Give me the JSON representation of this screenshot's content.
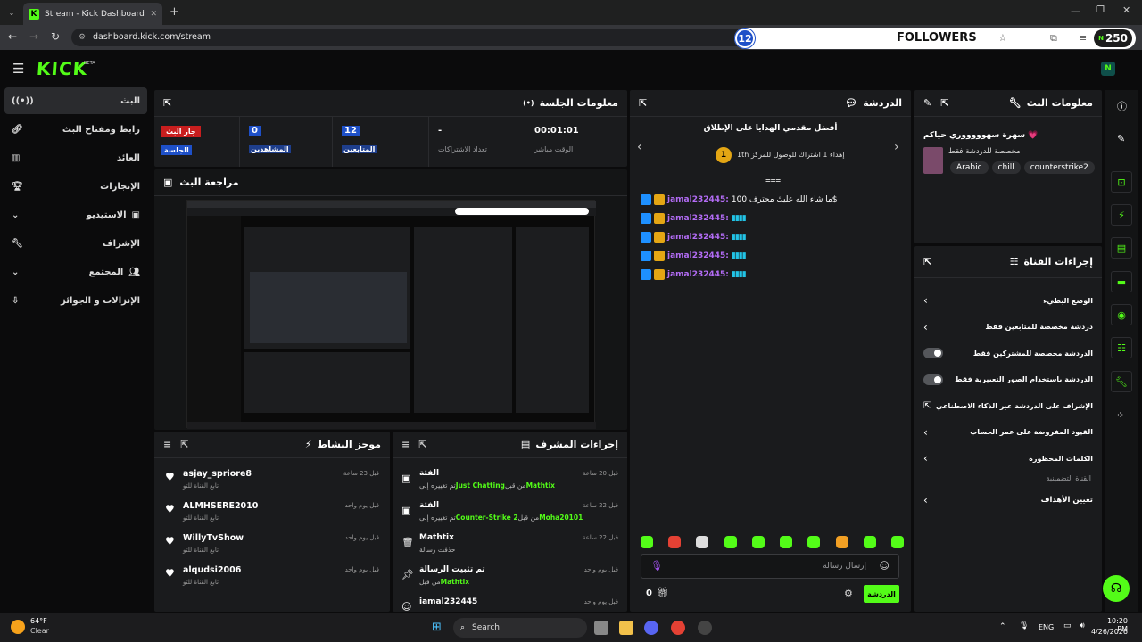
{
  "browser": {
    "tab_title": "Stream - Kick Dashboard",
    "url": "dashboard.kick.com/stream"
  },
  "overlay": {
    "left_number": "12",
    "label": "FOLLOWERS",
    "right_count": "250",
    "right_prefix": "N"
  },
  "header": {
    "logo": "KICK",
    "beta": "BETA"
  },
  "sidebar": {
    "items": [
      {
        "label": "البث"
      },
      {
        "label": "رابط ومفتاح البث"
      },
      {
        "label": "العائد"
      },
      {
        "label": "الإنجازات"
      },
      {
        "label": "الاستيديو"
      },
      {
        "label": "الإشراف"
      },
      {
        "label": "المجتمع"
      },
      {
        "label": "الإنزالات و الجوائز"
      }
    ]
  },
  "session": {
    "title": "معلومات الجلسة",
    "live_badge": "جار البث",
    "session_label": "الجلسة",
    "stats": [
      {
        "value": "0",
        "label": "المشاهدين"
      },
      {
        "value": "12",
        "label": "المتابعين"
      },
      {
        "value": "-",
        "label": "تعداد الاشتراكات"
      },
      {
        "value": "00:01:01",
        "label": "الوقت مباشر"
      }
    ]
  },
  "preview": {
    "title": "مراجعة البث"
  },
  "activity": {
    "title": "موجز النشاط",
    "items": [
      {
        "user": "asjay_spriore8",
        "sub": "تابع القناة للتو",
        "time": "قبل 23 ساعة"
      },
      {
        "user": "ALMHSERE2010",
        "sub": "تابع القناة للتو",
        "time": "قبل يوم واحد"
      },
      {
        "user": "WillyTvShow",
        "sub": "تابع القناة للتو",
        "time": "قبل يوم واحد"
      },
      {
        "user": "alqudsi2006",
        "sub": "تابع القناة للتو",
        "time": "قبل يوم واحد"
      }
    ]
  },
  "modactions": {
    "title": "إجراءات المشرف",
    "items": [
      {
        "title": "الفئة",
        "desc": "تم تغييره إلى",
        "hl": "Just Chatting",
        "by": "من قبل",
        "who": "Mathtix",
        "time": "قبل 20 ساعة"
      },
      {
        "title": "الفئة",
        "desc": "تم تغييره إلى",
        "hl": "Counter-Strike 2",
        "by": "من قبل",
        "who": "Moha20101",
        "time": "قبل 22 ساعة"
      },
      {
        "title": "Mathtix",
        "desc": "حذفت رسالة",
        "hl": "",
        "by": "",
        "who": "",
        "time": "قبل 22 ساعة"
      },
      {
        "title": "تم تثبيت الرسالة",
        "desc": "من قبل",
        "hl": "",
        "by": "",
        "who": "Mathtix",
        "time": "قبل يوم واحد"
      },
      {
        "title": "iamal232445",
        "desc": "",
        "hl": "",
        "by": "",
        "who": "",
        "time": "قبل يوم واحد"
      }
    ]
  },
  "chat": {
    "title": "الدردشة",
    "gifters_title": "أفضل مقدمي الهدايا على الإطلاق",
    "gifter_line": "إهداء 1 اشتراك للوصول للمركز 1",
    "gifter_rank": "1",
    "gifter_suffix": "th",
    "messages": [
      {
        "user": "jamal232445:",
        "text": "ما شاء الله عليك محترف 100$"
      },
      {
        "user": "jamal232445:",
        "text": "▮▮▮▮"
      },
      {
        "user": "jamal232445:",
        "text": "▮▮▮▮"
      },
      {
        "user": "jamal232445:",
        "text": "▮▮▮▮"
      },
      {
        "user": "jamal232445:",
        "text": "▮▮▮▮"
      }
    ],
    "input_placeholder": "إرسال رسالة",
    "points": "0",
    "send_label": "الدردشة"
  },
  "streaminfo": {
    "title": "معلومات البث",
    "stream_title": "سهرة سهوووووري حياكم 💗",
    "subtitle": "مخصصة للدردشة فقط",
    "tags": [
      "Arabic",
      "chill",
      "counterstrike2"
    ]
  },
  "channel_actions": {
    "title": "إجراءات القناة",
    "items": [
      {
        "label": "الوضع البطيء",
        "kind": "chevron"
      },
      {
        "label": "دردشة مخصصة للمتابعين فقط",
        "kind": "chevron"
      },
      {
        "label": "الدردشة مخصصة للمشتركين فقط",
        "kind": "toggle"
      },
      {
        "label": "الدردشة باستخدام الصور التعبيرية فقط",
        "kind": "toggle"
      },
      {
        "label": "الإشراف على الدردشة عبر الذكاء الاصطناعي",
        "kind": "link"
      },
      {
        "label": "القيود المفروضة على عمر الحساب",
        "kind": "chevron"
      },
      {
        "label": "الكلمات المحظورة",
        "kind": "chevron"
      }
    ],
    "section": "القناة التضمينية",
    "target_label": "تعيين الأهداف"
  },
  "taskbar": {
    "temp": "64°F",
    "weather": "Clear",
    "search": "Search",
    "lang": "ENG",
    "time": "10:20 PM",
    "date": "4/26/2026"
  },
  "colors": {
    "accent": "#53fc18",
    "bg": "#0b0b0c",
    "panel": "#1a1b1d"
  }
}
